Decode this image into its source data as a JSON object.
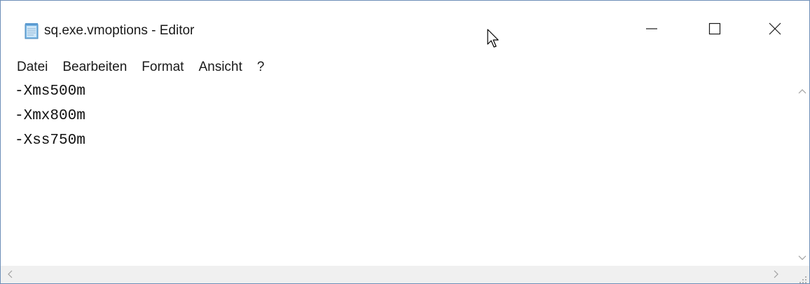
{
  "window": {
    "title": "sq.exe.vmoptions - Editor",
    "app_icon": "notepad-icon",
    "controls": {
      "minimize_icon": "minimize-icon",
      "maximize_icon": "maximize-icon",
      "close_icon": "close-icon"
    }
  },
  "menu": {
    "items": [
      {
        "label": "Datei"
      },
      {
        "label": "Bearbeiten"
      },
      {
        "label": "Format"
      },
      {
        "label": "Ansicht"
      },
      {
        "label": "?"
      }
    ]
  },
  "editor": {
    "lines": [
      "-Xms500m",
      "-Xmx800m",
      "-Xss750m"
    ]
  },
  "scrollbars": {
    "up_icon": "chevron-up-icon",
    "down_icon": "chevron-down-icon",
    "left_icon": "chevron-left-icon",
    "right_icon": "chevron-right-icon"
  },
  "colors": {
    "window_border": "#6d8fb8",
    "text": "#1a1a1a",
    "scrollbar_bg": "#f0f0f0",
    "scroll_arrow": "#a0a0a0"
  }
}
